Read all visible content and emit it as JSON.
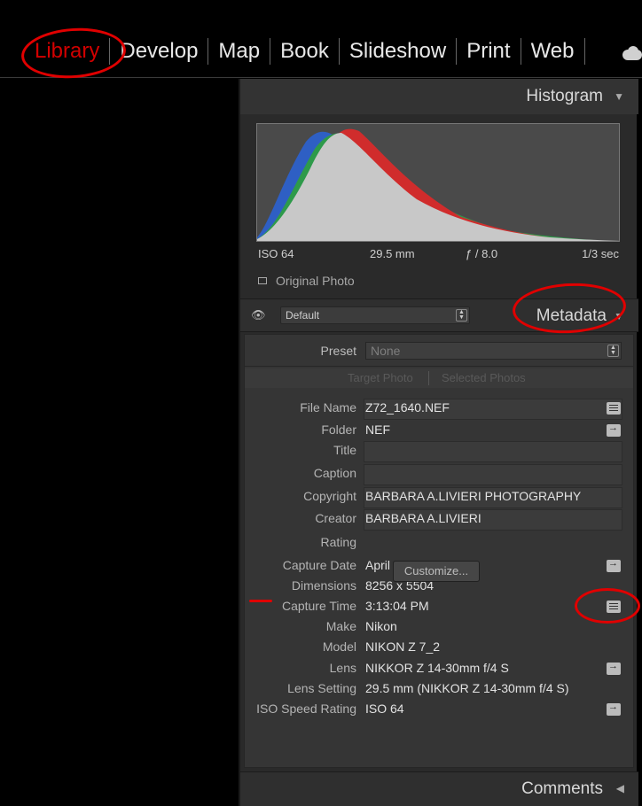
{
  "modules": [
    "Library",
    "Develop",
    "Map",
    "Book",
    "Slideshow",
    "Print",
    "Web"
  ],
  "histogram": {
    "title": "Histogram",
    "iso": "ISO 64",
    "focal": "29.5 mm",
    "aperture": "ƒ / 8.0",
    "shutter": "1/3 sec",
    "original_photo": "Original Photo"
  },
  "metadata": {
    "title": "Metadata",
    "preset_view": "Default",
    "preset_label": "Preset",
    "preset_value": "None",
    "tab_target": "Target Photo",
    "tab_selected": "Selected Photos",
    "rows": [
      {
        "label": "File Name",
        "value": "Z72_1640.NEF"
      },
      {
        "label": "Folder",
        "value": "NEF"
      },
      {
        "label": "Title",
        "value": ""
      },
      {
        "label": "Caption",
        "value": ""
      },
      {
        "label": "Copyright",
        "value": "BARBARA A.LIVIERI PHOTOGRAPHY"
      },
      {
        "label": "Creator",
        "value": "BARBARA A.LIVIERI"
      },
      {
        "label": "Rating",
        "value": ""
      },
      {
        "label": "Capture Date",
        "value": "April 10, 2025"
      },
      {
        "label": "Dimensions",
        "value": "8256 x 5504"
      },
      {
        "label": "Capture Time",
        "value": "3:13:04 PM"
      },
      {
        "label": "Make",
        "value": "Nikon"
      },
      {
        "label": "Model",
        "value": "NIKON Z 7_2"
      },
      {
        "label": "Lens",
        "value": "NIKKOR Z 14-30mm f/4 S"
      },
      {
        "label": "Lens Setting",
        "value": "29.5 mm (NIKKOR Z 14-30mm f/4 S)"
      },
      {
        "label": "ISO Speed Rating",
        "value": "ISO 64"
      }
    ],
    "customize": "Customize..."
  },
  "comments": {
    "title": "Comments"
  },
  "colors": {
    "annotation": "#e00000",
    "active_module": "#d20000"
  }
}
